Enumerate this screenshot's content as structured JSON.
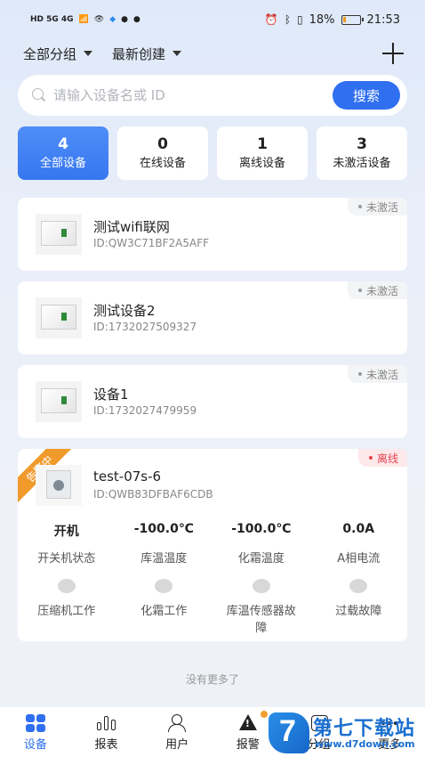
{
  "status_bar": {
    "left": "HD 5G 4G",
    "battery": "18%",
    "time": "21:53"
  },
  "filters": {
    "group": "全部分组",
    "sort": "最新创建"
  },
  "search": {
    "placeholder": "请输入设备名或 ID",
    "button": "搜索"
  },
  "stats": [
    {
      "count": "4",
      "label": "全部设备",
      "active": true
    },
    {
      "count": "0",
      "label": "在线设备"
    },
    {
      "count": "1",
      "label": "离线设备"
    },
    {
      "count": "3",
      "label": "未激活设备"
    }
  ],
  "devices": [
    {
      "name": "测试wifi联网",
      "id": "ID:QW3C71BF2A5AFF",
      "status": "未激活"
    },
    {
      "name": "测试设备2",
      "id": "ID:1732027509327",
      "status": "未激活"
    },
    {
      "name": "设备1",
      "id": "ID:1732027479959",
      "status": "未激活"
    },
    {
      "name": "test-07s-6",
      "id": "ID:QWB83DFBAF6CDB",
      "status": "离线",
      "alarm": "告警中",
      "metrics": [
        {
          "value": "开机",
          "label": "开关机状态"
        },
        {
          "value": "-100.0℃",
          "label": "库温温度"
        },
        {
          "value": "-100.0℃",
          "label": "化霜温度"
        },
        {
          "value": "0.0A",
          "label": "A相电流"
        }
      ],
      "indicators": [
        {
          "label": "压缩机工作"
        },
        {
          "label": "化霜工作"
        },
        {
          "label": "库温传感器故障"
        },
        {
          "label": "过载故障"
        }
      ]
    }
  ],
  "footer_note": "没有更多了",
  "nav": [
    {
      "label": "设备",
      "icon": "grid-icon",
      "active": true
    },
    {
      "label": "报表",
      "icon": "bar-chart-icon"
    },
    {
      "label": "用户",
      "icon": "users-icon"
    },
    {
      "label": "报警",
      "icon": "warning-icon"
    },
    {
      "label": "分组",
      "icon": "group-icon"
    },
    {
      "label": "更多",
      "icon": "more-icon"
    }
  ],
  "watermark": {
    "title": "第七下载站",
    "url": "www.d7down.com"
  }
}
